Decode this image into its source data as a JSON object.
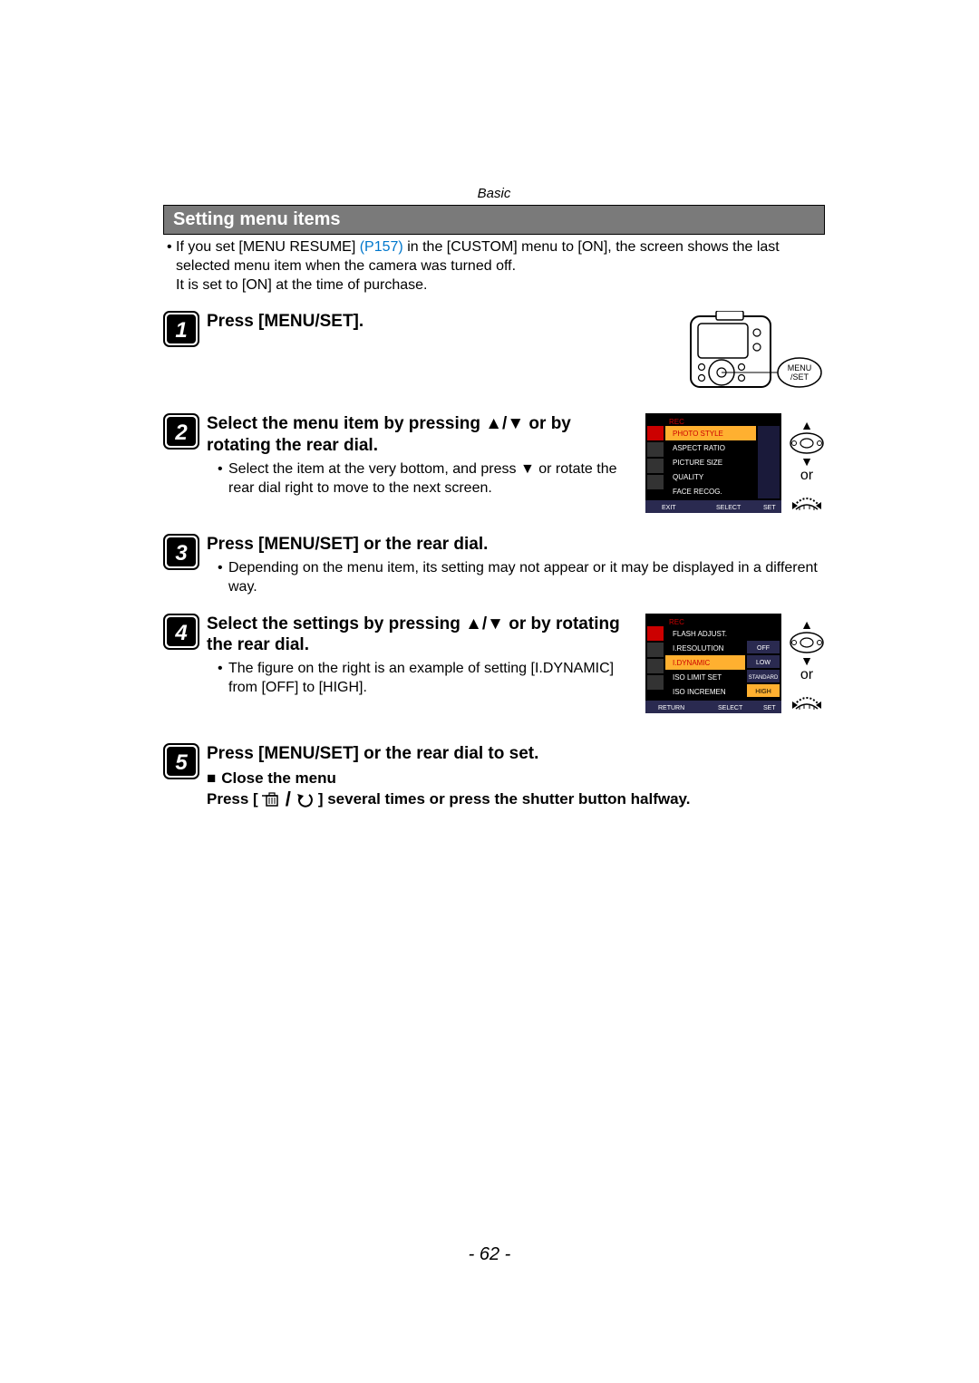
{
  "chapter": "Basic",
  "section_title": "Setting menu items",
  "intro": {
    "line1a": "If you set [MENU RESUME] ",
    "link": "(P157)",
    "line1b": " in the [CUSTOM] menu to [ON], the screen shows the last selected menu item when the camera was turned off.",
    "line2": "It is set to [ON] at the time of purchase."
  },
  "step1": {
    "title": "Press [MENU/SET]."
  },
  "step2": {
    "title": "Select the menu item by pressing ▲/▼ or by rotating the rear dial.",
    "sub": "Select the item at the very bottom, and press ▼ or rotate the rear dial right to move to the next screen.",
    "or": "or"
  },
  "step3": {
    "title": "Press [MENU/SET] or the rear dial.",
    "sub": "Depending on the menu item, its setting may not appear or it may be displayed in a different way."
  },
  "step4": {
    "title": "Select the settings by pressing ▲/▼ or by rotating the rear dial.",
    "sub": "The figure on the right is an example of setting [I.DYNAMIC] from [OFF] to [HIGH].",
    "or": "or"
  },
  "step5": {
    "title": "Press [MENU/SET] or the rear dial to set.",
    "close_title": "Close the menu",
    "close_pre": "Press [",
    "close_post": "] several times or press the shutter button halfway."
  },
  "menu_screen1": {
    "header": "REC",
    "items": [
      "PHOTO STYLE",
      "ASPECT RATIO",
      "PICTURE SIZE",
      "QUALITY",
      "FACE RECOG."
    ],
    "footer_left": "EXIT",
    "footer_mid": "SELECT",
    "footer_right": "SET"
  },
  "menu_screen2": {
    "header": "REC",
    "items": [
      "FLASH ADJUST.",
      "I.RESOLUTION",
      "I.DYNAMIC",
      "ISO LIMIT SET",
      "ISO INCREMEN"
    ],
    "vals": [
      "",
      "OFF",
      "LOW",
      "STANDARD",
      "HIGH"
    ],
    "footer_left": "RETURN",
    "footer_mid": "SELECT",
    "footer_right": "SET"
  },
  "camera_button": {
    "line1": "MENU",
    "line2": "/SET"
  },
  "page_number": "- 62 -"
}
